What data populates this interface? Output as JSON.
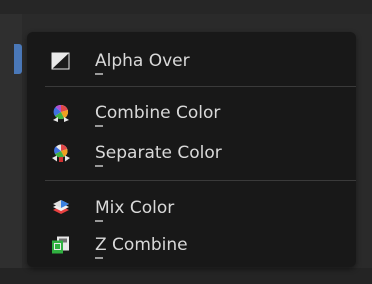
{
  "menu": {
    "items": [
      {
        "label": "Alpha Over",
        "icon": "alpha-over-icon"
      },
      {
        "label": "Combine Color",
        "icon": "combine-color-icon"
      },
      {
        "label": "Separate Color",
        "icon": "separate-color-icon"
      },
      {
        "label": "Mix Color",
        "icon": "mix-color-icon"
      },
      {
        "label": "Z Combine",
        "icon": "z-combine-icon"
      }
    ]
  }
}
